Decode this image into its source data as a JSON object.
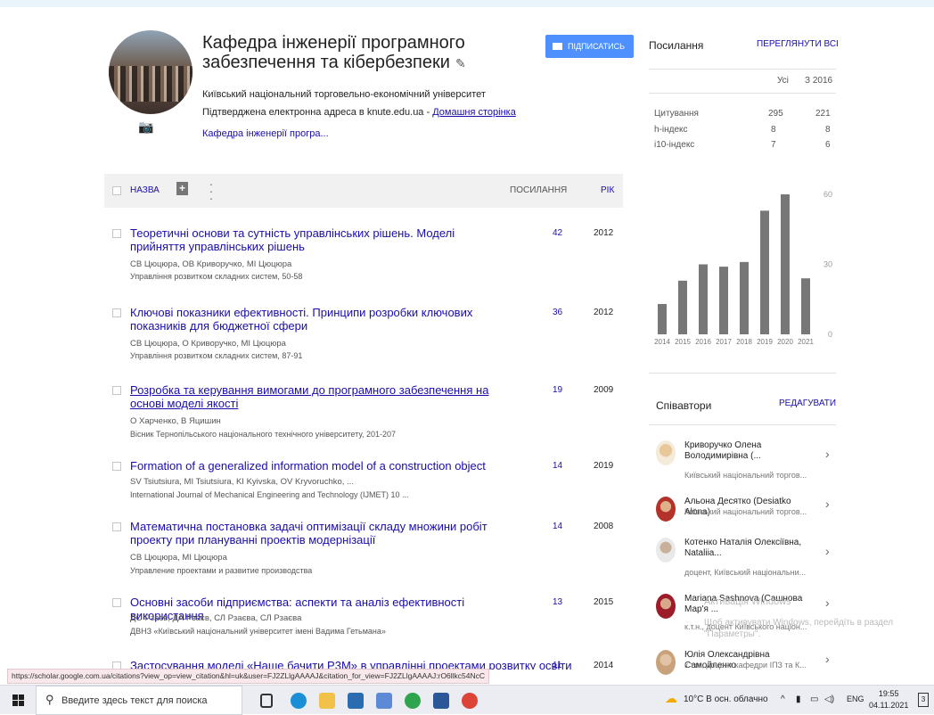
{
  "profile": {
    "name": "Кафедра інженерії програмного забезпечення та кібербезпеки",
    "affiliation": "Київський національний торговельно-економічний університет",
    "email_text": "Підтверджена електронна адреса в knute.edu.ua - ",
    "homepage": "Домашня сторінка",
    "interest": "Кафедра інженерії програ...",
    "follow_label": "ПІДПИСАТИСЬ"
  },
  "table": {
    "title_col": "НАЗВА",
    "cited_col": "ПОСИЛАННЯ",
    "year_col": "РІК",
    "rows": [
      {
        "title": "Теоретичні основи та сутність управлінських рішень. Моделі прийняття управлінських рішень",
        "authors": "СВ Цюцюра, ОВ Криворучко, МІ Цюцюра",
        "venue": "Управління розвитком складних систем, 50-58",
        "cited": "42",
        "year": "2012"
      },
      {
        "title": "Ключові показники ефективності. Принципи розробки ключових показників для бюджетної сфери",
        "authors": "СВ Цюцюра, О Криворучко, МІ Цюцюра",
        "venue": "Управління розвитком складних систем, 87-91",
        "cited": "36",
        "year": "2012"
      },
      {
        "title": "Розробка та керування вимогами до програмного забезпечення на основі моделі якості",
        "authors": "О Харченко, В Яцишин",
        "venue": "Вісник Тернопільського національного технічного університету, 201-207",
        "cited": "19",
        "year": "2009"
      },
      {
        "title": "Formation of a generalized information model of a construction object",
        "authors": "SV Tsiutsiura, MI Tsiutsiura, KI Kyivska, OV Kryvoruchko, ...",
        "venue": "International Journal of Mechanical Engineering and Technology (IJMET) 10 ...",
        "cited": "14",
        "year": "2019"
      },
      {
        "title": "Математична постановка задачі оптимізації складу множини робіт проекту при плануванні проектів модернізації",
        "authors": "СВ Цюцюра, МІ Цюцюра",
        "venue": "Управление проектами и развитие производства",
        "cited": "14",
        "year": "2008"
      },
      {
        "title": "Основні засоби підприємства: аспекти та аналіз ефективності використання",
        "authors": "ДО Рзаєв, ДА Рзаєв, СЛ Рзаєва, СЛ Рзаєва",
        "venue": "ДВНЗ «Київський національний університет імені Вадима Гетьмана»",
        "cited": "13",
        "year": "2015"
      },
      {
        "title": "Застосування моделі «Наше бачити P3M» в управлінні проектами розвитку освіти",
        "authors": "",
        "venue": "",
        "cited": "11",
        "year": "2014"
      }
    ]
  },
  "cited_by": {
    "heading": "Посилання",
    "view_all": "ПЕРЕГЛЯНУТИ ВСІ",
    "col_all": "Усі",
    "col_since": "З 2016",
    "stats": [
      {
        "label": "Цитування",
        "all": "295",
        "since": "221"
      },
      {
        "label": "h-індекс",
        "all": "8",
        "since": "8"
      },
      {
        "label": "i10-індекс",
        "all": "7",
        "since": "6"
      }
    ]
  },
  "chart_data": {
    "type": "bar",
    "categories": [
      "2014",
      "2015",
      "2016",
      "2017",
      "2018",
      "2019",
      "2020",
      "2021"
    ],
    "values": [
      13,
      23,
      30,
      29,
      31,
      53,
      60,
      24
    ],
    "ylim": [
      0,
      60
    ],
    "yticks": [
      "60",
      "30",
      "0"
    ],
    "color": "#777777"
  },
  "coauthors": {
    "heading": "Співавтори",
    "edit": "РЕДАГУВАТИ",
    "items": [
      {
        "name": "Криворучко Олена Володимирівна (...",
        "aff": "Київський національний торгов..."
      },
      {
        "name": "Альона Десятко (Desiatko Alona)",
        "aff": "Київський національний торгов..."
      },
      {
        "name": "Котенко Наталія Олексіївна, Nataliia...",
        "aff": "доцент, Київський національни..."
      },
      {
        "name": "Mariana Sashnova (Сашнова Мар'я ...",
        "aff": "к.т.н., доцент Київського націон..."
      },
      {
        "name": "Юлія Олександрівна Самойленко",
        "aff": "к.т.н., доцент кафедри ІПЗ та К..."
      }
    ]
  },
  "watermark": {
    "line1": "Активація Windows",
    "line2": "Щоб активувати Windows, перейдіть в раздел \"Параметры\"."
  },
  "status_url": "https://scholar.google.com.ua/citations?view_op=view_citation&hl=uk&user=FJ2ZLlgAAAAJ&citation_for_view=FJ2ZLlgAAAAJ:rO6llkc54NcC",
  "taskbar": {
    "search_placeholder": "Введите здесь текст для поиска",
    "weather": "10°C  В осн. облачно",
    "lang": "ENG",
    "time": "19:55",
    "date": "04.11.2021",
    "notif": "3"
  }
}
